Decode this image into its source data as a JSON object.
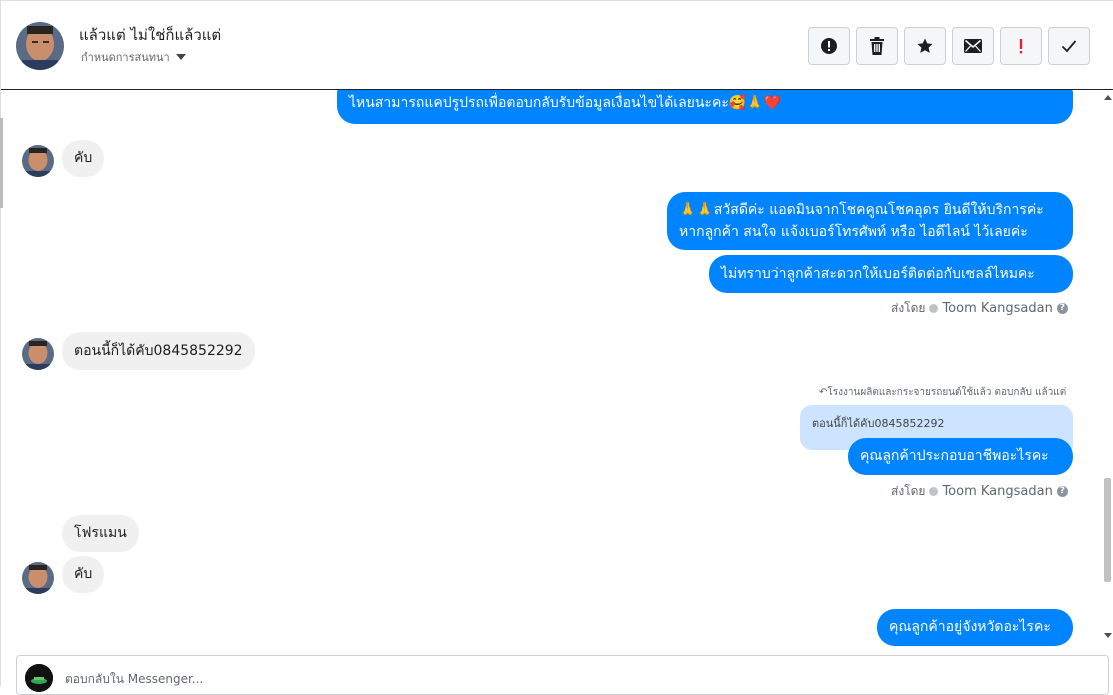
{
  "header": {
    "name": "แล้วแต่ ไม่ใช่ก็แล้วแต่",
    "assign_label": "กำหนดการสนทนา",
    "actions": [
      {
        "name": "mark-spam-button",
        "icon": "exclamation-circle-icon"
      },
      {
        "name": "delete-button",
        "icon": "trash-icon"
      },
      {
        "name": "star-button",
        "icon": "star-icon"
      },
      {
        "name": "mark-unread-button",
        "icon": "envelope-icon"
      },
      {
        "name": "follow-up-button",
        "icon": "exclamation-red-icon"
      },
      {
        "name": "mark-done-button",
        "icon": "check-icon"
      }
    ]
  },
  "messages": {
    "m0_partial": "ไหนสามารถแคปรูปรถเพื่อตอบกลับรับข้อมูลเงื่อนไขได้เลยนะคะ🥰🙏❤️",
    "m1": "คับ",
    "m2_line1": "🙏🙏สวัสดีค่ะ แอดมินจากโชคคูณโชคอุดร ยินดีให้บริการค่ะ",
    "m2_line2": "หากลูกค้า สนใจ แจ้งเบอร์โทรศัพท์ หรือ ไอดีไลน์  ไว้เลยค่ะ",
    "m3": "ไม่ทราบว่าลูกค้าสะดวกให้เบอร์ติดต่อกับเซลล์ไหมคะ",
    "sent_by_label": "ส่งโดย",
    "sender_name": "Toom Kangsadan",
    "m4": "ตอนนี้ก็ได้คับ0845852292",
    "reply_context": "↶โรงงานผลิตและกระจายรถยนต์ใช้แล้ว ตอบกลับ แล้วแต่",
    "quoted_text": "ตอนนี้ก็ได้คับ0845852292",
    "m5": "คุณลูกค้าประกอบอาชีพอะไรคะ",
    "m6": "โฟรแมน",
    "m7": "คับ",
    "m8": "คุณลูกค้าอยู่จังหวัดอะไรคะ"
  },
  "composer": {
    "placeholder": "ตอบกลับใน Messenger..."
  },
  "colors": {
    "outgoing": "#0084ff",
    "incoming": "#f0f0f0",
    "quote": "#cce4ff"
  }
}
